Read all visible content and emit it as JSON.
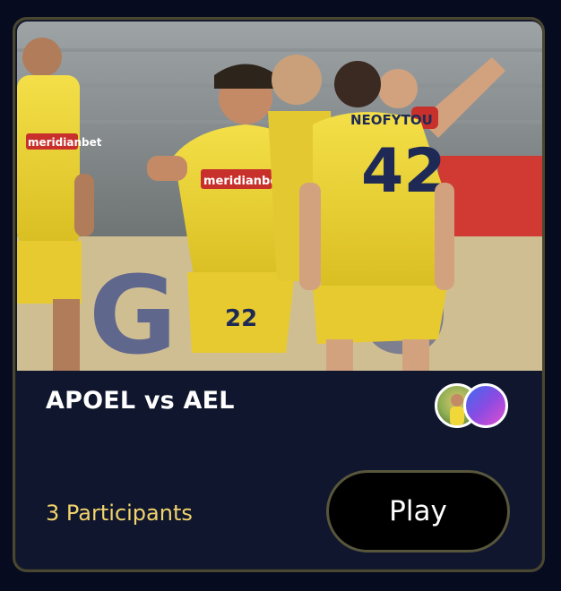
{
  "match": {
    "title": "APOEL vs AEL",
    "participants_label": "3 Participants",
    "play_label": "Play"
  },
  "photo": {
    "sponsor": "meridianbet",
    "player_name": "NEOFYTOU",
    "player_number": "42",
    "teammate_number": "22"
  },
  "colors": {
    "page_bg": "#070b1f",
    "card_bg": "#0f162d",
    "card_border": "#4a4731",
    "accent": "#f2d36c",
    "button_bg": "#000000",
    "jersey_yellow": "#f1d83a",
    "jersey_blue": "#1f3ea0"
  }
}
